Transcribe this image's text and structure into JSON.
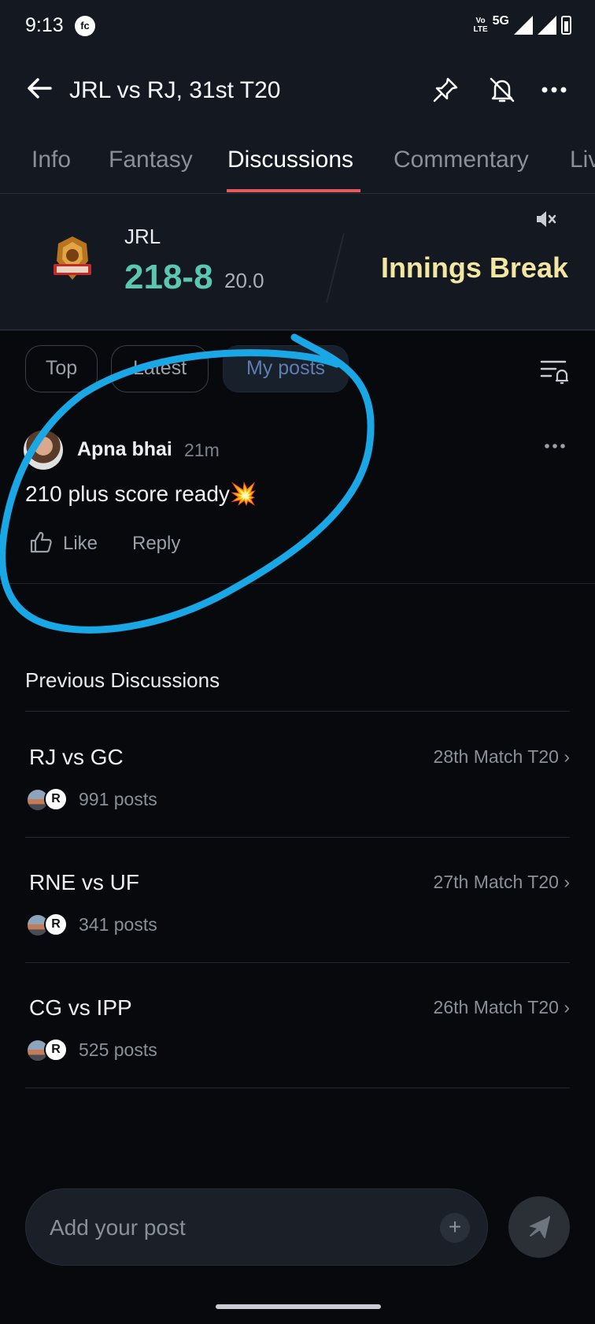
{
  "status_bar": {
    "time": "9:13",
    "app_badge": "fc",
    "volte_line1": "Vo",
    "volte_line2": "LTE",
    "network": "5G"
  },
  "header": {
    "title": "JRL vs RJ, 31st T20"
  },
  "tabs": [
    "Info",
    "Fantasy",
    "Discussions",
    "Commentary",
    "Liv"
  ],
  "active_tab": "Discussions",
  "score": {
    "team": "JRL",
    "runs": "218-8",
    "overs": "20.0",
    "status": "Innings Break"
  },
  "filters": [
    "Top",
    "Latest",
    "My posts"
  ],
  "active_filter": "My posts",
  "post": {
    "author": "Apna bhai",
    "time": "21m",
    "text": "210 plus score ready💥",
    "like_label": "Like",
    "reply_label": "Reply"
  },
  "previous": {
    "title": "Previous Discussions",
    "items": [
      {
        "name": "RJ vs GC",
        "match": "28th Match T20 ›",
        "posts": "991 posts",
        "badge": "R"
      },
      {
        "name": "RNE vs UF",
        "match": "27th Match T20 ›",
        "posts": "341 posts",
        "badge": "R"
      },
      {
        "name": "CG vs IPP",
        "match": "26th Match T20 ›",
        "posts": "525 posts",
        "badge": "R"
      }
    ]
  },
  "composer": {
    "placeholder": "Add your post",
    "plus": "+"
  },
  "colors": {
    "accent_underline": "#e55a5a",
    "runs": "#5cc7b1",
    "innings_status": "#f2e6a2",
    "annotation": "#1aa7e6"
  }
}
